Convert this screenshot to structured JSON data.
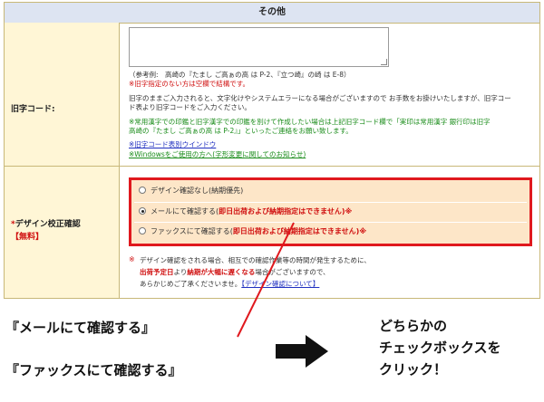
{
  "section": {
    "title": "その他"
  },
  "kyuji": {
    "label": "旧字コード:",
    "example": "（参考例:　高崎の『たまし ご高ぁの高 は P-2、『立つ崎』の崎 は E-8）",
    "warning_none": "※旧字指定のない方は空欄で結構です。",
    "info1": "旧字のままご入力されると、文字化けやシステムエラーになる場合がございますので お手数をお掛けいたしますが、旧字コー",
    "info2": "ド表より旧字コードをご入力ください。",
    "green1": "※常用漢字での印鑑と旧字漢字での印鑑を別けて作成したい場合は上記旧字コード欄で「実印は常用漢字 銀行印は旧字",
    "green2": "高崎の『たまし ご高ぁの高 は P-2』」といったご連絡をお願い致します。",
    "link_table": "※旧字コード表別ウインドウ",
    "link_windows": "※Windowsをご使用の方へ(字形変更に関してのお知らせ)"
  },
  "design": {
    "label_asterisk": "*",
    "label": "デザイン校正確認",
    "label_sub": "【無料】",
    "options": [
      {
        "label": "デザイン確認なし(納期優先)",
        "warn": "",
        "suffix": "",
        "checked": false
      },
      {
        "label": "メールにて確認する(",
        "warn": "即日出荷および納期指定はできません",
        "suffix": ")※",
        "checked": true
      },
      {
        "label": "ファックスにて確認する(",
        "warn": "即日出荷および納期指定はできません",
        "suffix": ")※",
        "checked": false
      }
    ],
    "note_mark": "※",
    "note1": "デザイン確認をされる場合、相互での確認作業等の時間が発生するために、",
    "note2_a": "出荷予定日",
    "note2_b": "より",
    "note2_c": "納期が大幅に遅くなる",
    "note2_d": "場合がございますので、",
    "note3": "あらかじめご了承くださいませ。",
    "note3_link": "【デザイン確認について】"
  },
  "annotation": {
    "callout1": "『メールにて確認する』",
    "callout2": "『ファックスにて確認する』",
    "right_line1": "どちらかの",
    "right_line2": "チェックボックスを",
    "right_line3": "クリック！",
    "line_color": "#e0191e",
    "arrow_color": "#111111"
  }
}
